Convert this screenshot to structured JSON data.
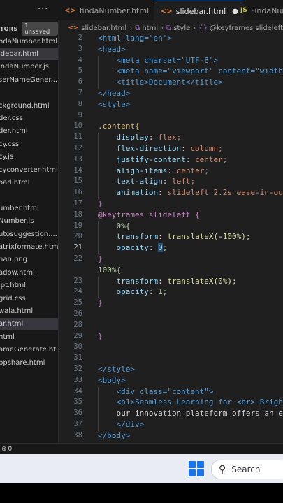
{
  "tabs": [
    {
      "label": "findaNumber.html",
      "icon": "html-icon",
      "active": false
    },
    {
      "label": "slidebar.html",
      "icon": "html-icon",
      "active": true,
      "modified": true
    },
    {
      "label": "FindaNum",
      "icon": "js-icon",
      "active": false
    }
  ],
  "explorer": {
    "title": "TORS",
    "unsaved_badge": "1 unsaved",
    "files": [
      "ndaNumber.html",
      "idebar.html",
      "indaNumber.js",
      "serNameGener...",
      "",
      "ckground.html",
      "der.css",
      "der.html",
      "cy.css",
      "cy.js",
      "cyconverter.html",
      "oad.html",
      "",
      "umber.html",
      "Number.js",
      "utosuggestion....",
      "atrixformate.html",
      "nan.png",
      "adow.html",
      "ipt.html",
      "grid.css",
      "wala.html",
      "ar.html",
      "html",
      "ameGenerate.ht...",
      "ppshare.html"
    ]
  },
  "breadcrumb": [
    "slidebar.html",
    "html",
    "style",
    "@keyframes slideleft"
  ],
  "editor": {
    "lines": [
      {
        "n": "2",
        "text": "<html lang=\"en\">"
      },
      {
        "n": "3",
        "text": "<head>"
      },
      {
        "n": "4",
        "text": "<meta charset=\"UTF-8\">"
      },
      {
        "n": "5",
        "text": "<meta name=\"viewport\" content=\"width=d"
      },
      {
        "n": "6",
        "text": "<title>Document</title>"
      },
      {
        "n": "7",
        "text": "</head>"
      },
      {
        "n": "8",
        "text": "<style>"
      },
      {
        "n": "9",
        "text": ""
      },
      {
        "n": "10",
        "text": ".content{"
      },
      {
        "n": "11",
        "text": "display: flex;"
      },
      {
        "n": "12",
        "text": "flex-direction: column;"
      },
      {
        "n": "13",
        "text": "justify-content: center;"
      },
      {
        "n": "14",
        "text": "align-items: center;"
      },
      {
        "n": "15",
        "text": "text-align: left;"
      },
      {
        "n": "16",
        "text": "animation: slideleft 2.2s ease-in-out"
      },
      {
        "n": "17",
        "text": "}"
      },
      {
        "n": "18",
        "text": "@keyframes slideleft {"
      },
      {
        "n": "19",
        "text": "0%{"
      },
      {
        "n": "20",
        "text": "transform: translateX(-100%);"
      },
      {
        "n": "21",
        "text": "opacity: 0;"
      },
      {
        "n": "22",
        "text": "}"
      },
      {
        "n": "",
        "text": "100%{"
      },
      {
        "n": "23",
        "text": "transform: translateX(0%);"
      },
      {
        "n": "24",
        "text": "opacity: 1;"
      },
      {
        "n": "25",
        "text": "}"
      },
      {
        "n": "26",
        "text": ""
      },
      {
        "n": "28",
        "text": ""
      },
      {
        "n": "29",
        "text": "}"
      },
      {
        "n": "30",
        "text": ""
      },
      {
        "n": "31",
        "text": ""
      },
      {
        "n": "32",
        "text": "</style>"
      },
      {
        "n": "33",
        "text": "<body>"
      },
      {
        "n": "34",
        "text": "<div class=\"content\">"
      },
      {
        "n": "35",
        "text": "<h1>Seamless Learning for <br> Brighte"
      },
      {
        "n": "36",
        "text": "our innovation plateform offers an ef"
      },
      {
        "n": "37",
        "text": "</div>"
      },
      {
        "n": "38",
        "text": "</body>"
      }
    ]
  },
  "statusbar": {
    "errors": "0"
  },
  "taskbar": {
    "search_label": "Search"
  }
}
